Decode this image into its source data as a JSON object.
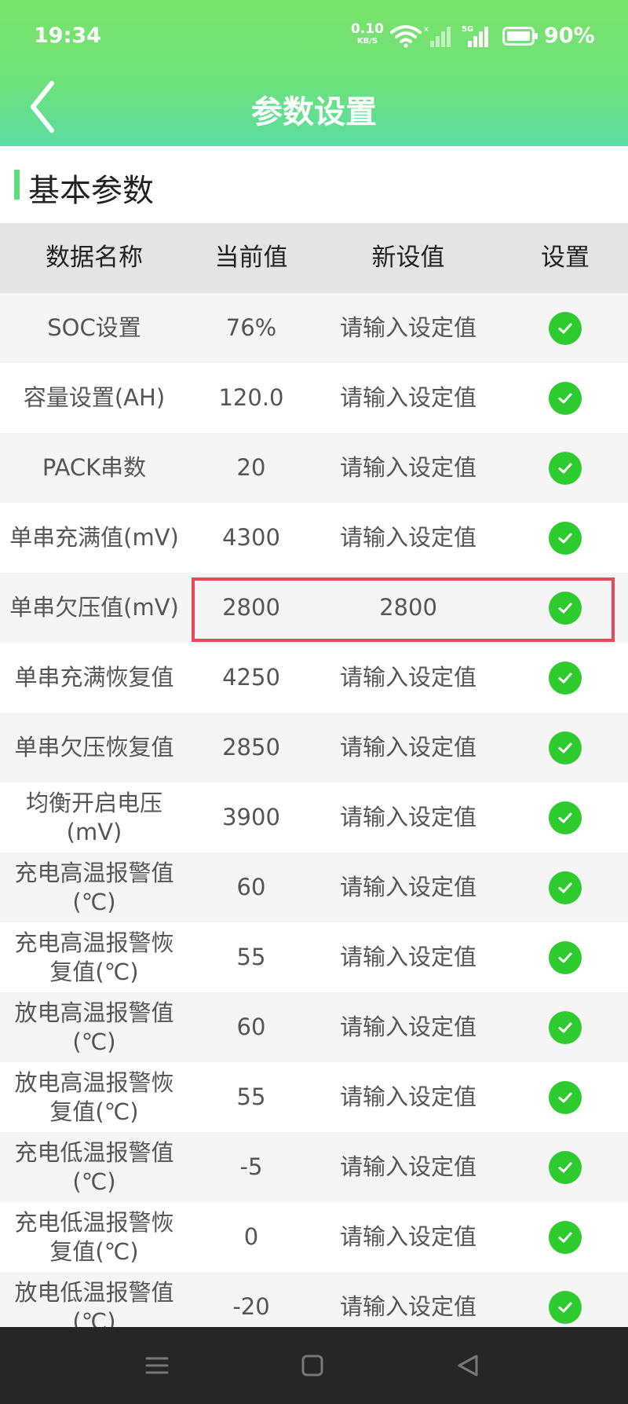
{
  "status": {
    "time": "19:34",
    "speed": "0.10",
    "speed_unit": "KB/S",
    "network": "5G",
    "battery": "90%"
  },
  "header": {
    "title": "参数设置"
  },
  "section": {
    "title": "基本参数"
  },
  "table": {
    "headers": [
      "数据名称",
      "当前值",
      "新设值",
      "设置"
    ],
    "placeholder": "请输入设定值",
    "rows": [
      {
        "name": "SOC设置",
        "current": "76%",
        "new_value": ""
      },
      {
        "name": "容量设置(AH)",
        "current": "120.0",
        "new_value": ""
      },
      {
        "name": "PACK串数",
        "current": "20",
        "new_value": ""
      },
      {
        "name": "单串充满值(mV)",
        "current": "4300",
        "new_value": ""
      },
      {
        "name": "单串欠压值(mV)",
        "current": "2800",
        "new_value": "2800"
      },
      {
        "name": "单串充满恢复值",
        "current": "4250",
        "new_value": ""
      },
      {
        "name": "单串欠压恢复值",
        "current": "2850",
        "new_value": ""
      },
      {
        "name": "均衡开启电压(mV)",
        "current": "3900",
        "new_value": ""
      },
      {
        "name": "充电高温报警值(℃)",
        "current": "60",
        "new_value": ""
      },
      {
        "name": "充电高温报警恢复值(℃)",
        "current": "55",
        "new_value": ""
      },
      {
        "name": "放电高温报警值(℃)",
        "current": "60",
        "new_value": ""
      },
      {
        "name": "放电高温报警恢复值(℃)",
        "current": "55",
        "new_value": ""
      },
      {
        "name": "充电低温报警值(℃)",
        "current": "-5",
        "new_value": ""
      },
      {
        "name": "充电低温报警恢复值(℃)",
        "current": "0",
        "new_value": ""
      },
      {
        "name": "放电低温报警值(℃)",
        "current": "-20",
        "new_value": ""
      }
    ]
  },
  "colors": {
    "accent": "#5edc7a",
    "header_gradient_top": "#7be36a",
    "header_gradient_bottom": "#5bdca4",
    "check": "#2ecb2e",
    "highlight": "#e84a55",
    "navbar": "#262626"
  },
  "icons": {
    "back": "chevron-left-icon",
    "set": "check-circle-icon",
    "nav": [
      "menu-icon",
      "home-square-icon",
      "back-triangle-icon"
    ]
  }
}
